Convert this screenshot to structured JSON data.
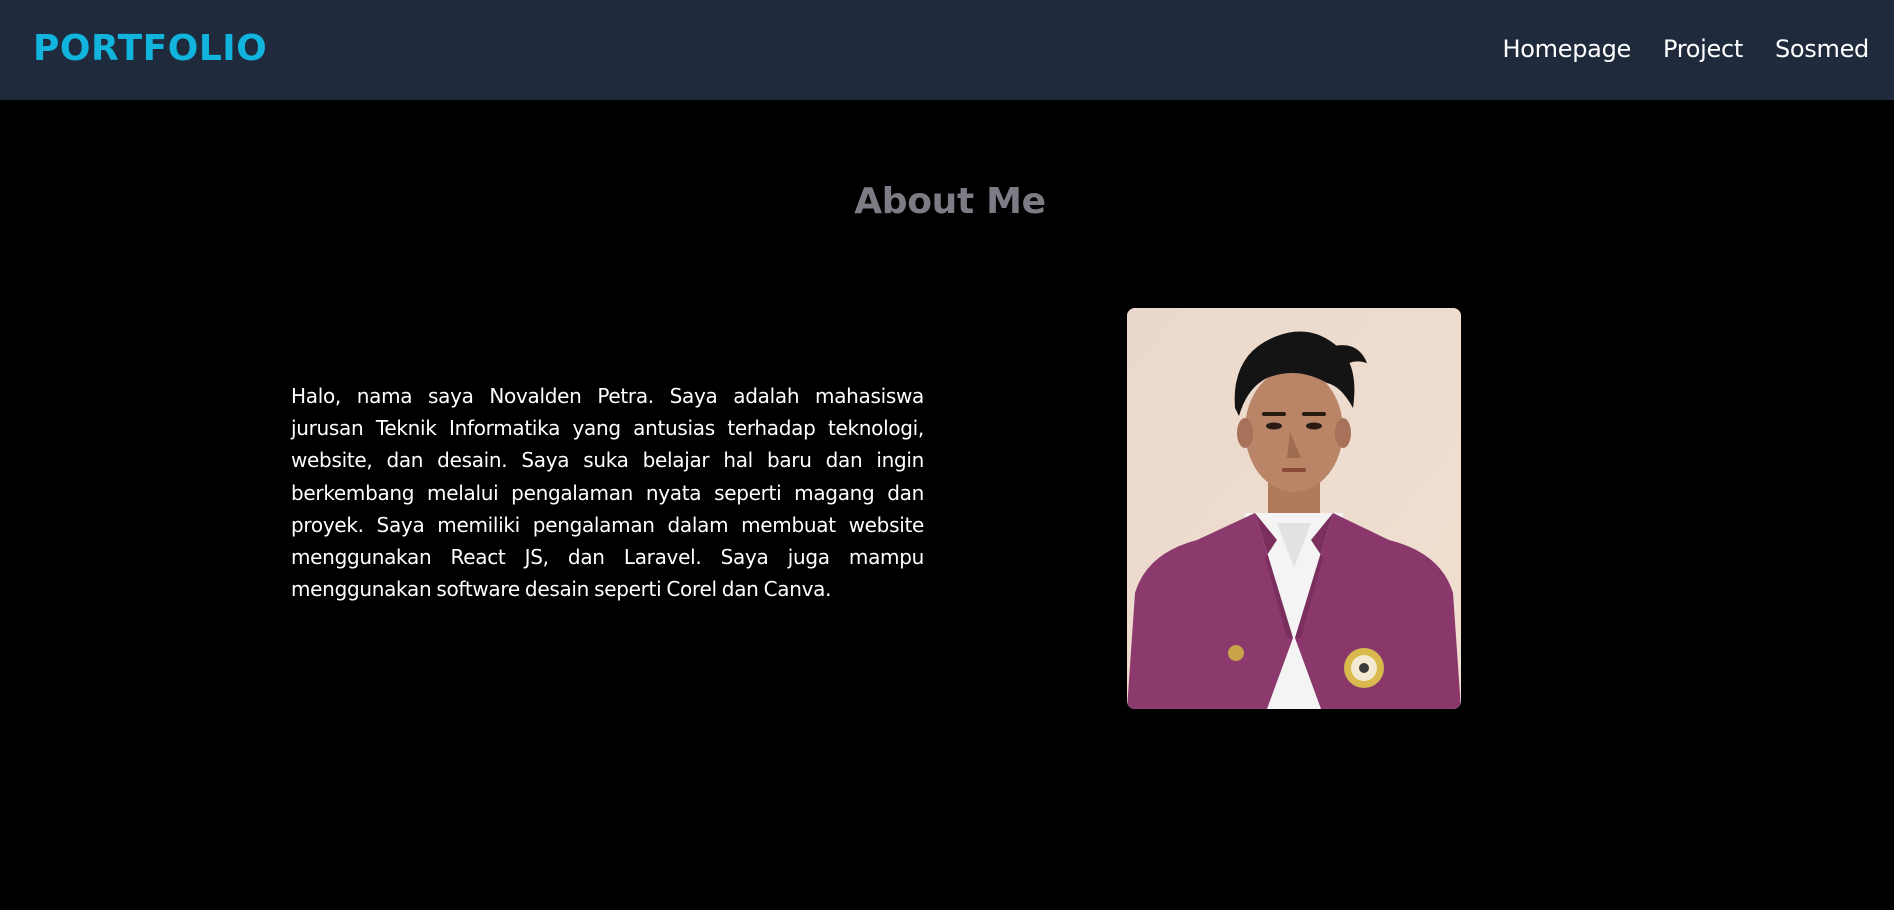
{
  "navbar": {
    "brand": "PORTFOLIO",
    "links": [
      "Homepage",
      "Project",
      "Sosmed"
    ]
  },
  "about": {
    "title": "About Me",
    "paragraph": "Halo, nama saya Novalden Petra. Saya adalah mahasiswa jurusan Teknik Informatika yang antusias terhadap teknologi, website, dan desain. Saya suka belajar hal baru dan ingin berkembang melalui pengalaman nyata seperti magang dan proyek. Saya memiliki pengalaman dalam membuat website menggunakan React JS, dan Laravel. Saya juga mampu menggunakan software desain seperti Corel dan Canva."
  },
  "colors": {
    "navbar_bg": "#1f2a3c",
    "brand": "#10b4dc",
    "page_bg": "#000000",
    "title": "#7c7c84",
    "text": "#ffffff",
    "jacket": "#8c3a6e"
  }
}
